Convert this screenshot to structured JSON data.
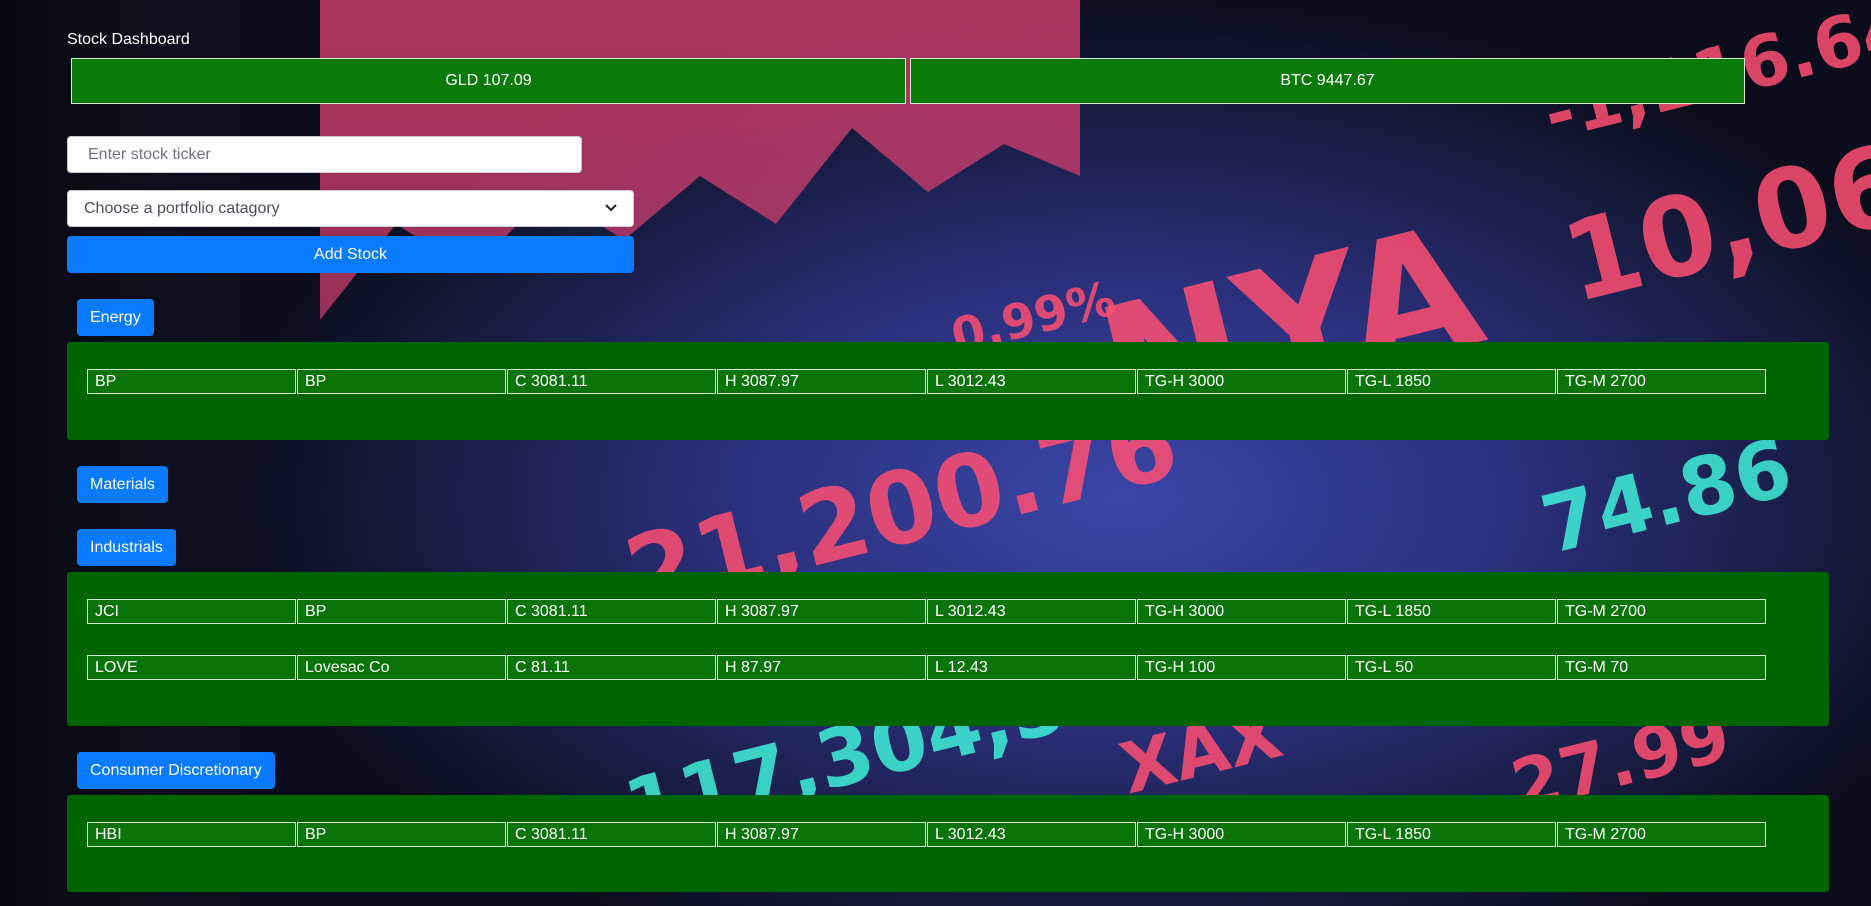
{
  "page": {
    "title": "Stock Dashboard"
  },
  "tickers": [
    {
      "label": "GLD 107.09"
    },
    {
      "label": "BTC 9447.67"
    }
  ],
  "form": {
    "ticker_placeholder": "Enter stock ticker",
    "category_select": "Choose a portfolio catagory",
    "add_button": "Add Stock"
  },
  "categories": [
    {
      "name": "Energy",
      "stocks": [
        {
          "ticker": "BP",
          "name": "BP",
          "close": "C 3081.11",
          "high": "H 3087.97",
          "low": "L 3012.43",
          "target_high": "TG-H 3000",
          "target_low": "TG-L 1850",
          "target_mid": "TG-M 2700"
        }
      ]
    },
    {
      "name": "Materials",
      "stocks": []
    },
    {
      "name": "Industrials",
      "stocks": [
        {
          "ticker": "JCI",
          "name": "BP",
          "close": "C 3081.11",
          "high": "H 3087.97",
          "low": "L 3012.43",
          "target_high": "TG-H 3000",
          "target_low": "TG-L 1850",
          "target_mid": "TG-M 2700"
        },
        {
          "ticker": "LOVE",
          "name": "Lovesac Co",
          "close": "C 81.11",
          "high": "H 87.97",
          "low": "L 12.43",
          "target_high": "TG-H 100",
          "target_low": "TG-L 50",
          "target_mid": "TG-M 70"
        }
      ]
    },
    {
      "name": "Consumer Discretionary",
      "stocks": [
        {
          "ticker": "HBI",
          "name": "BP",
          "close": "C 3081.11",
          "high": "H 3087.97",
          "low": "L 3012.43",
          "target_high": "TG-H 3000",
          "target_low": "TG-L 1850",
          "target_mid": "TG-M 2700"
        }
      ]
    }
  ],
  "colors": {
    "ticker_bg": "#0a7a0a",
    "panel_bg": "#006400",
    "button_blue": "#0a7bff"
  }
}
